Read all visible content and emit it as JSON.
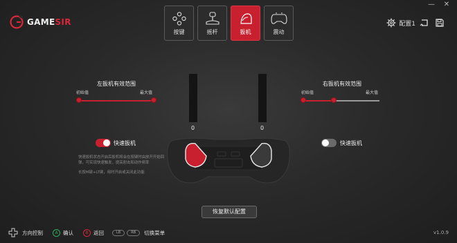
{
  "brand": {
    "name_left": "GAME",
    "name_right": "SIR"
  },
  "window": {
    "minimize": "—",
    "close": "✕"
  },
  "tabs": [
    {
      "label": "按键",
      "icon": "dpad-buttons-icon",
      "active": false
    },
    {
      "label": "摇杆",
      "icon": "joystick-icon",
      "active": false
    },
    {
      "label": "扳机",
      "icon": "trigger-icon",
      "active": true
    },
    {
      "label": "震动",
      "icon": "vibration-controller-icon",
      "active": false
    }
  ],
  "header": {
    "config_label": "配置1"
  },
  "left_range": {
    "title": "左扳机有效范围",
    "min_label": "初始值",
    "max_label": "最大值",
    "min_value": 0.0,
    "max_value": 1.0
  },
  "right_range": {
    "title": "右扳机有效范围",
    "min_label": "初始值",
    "max_label": "最大值",
    "min_value": 0.0,
    "max_value": 0.42
  },
  "left_trigger_value": "0",
  "right_trigger_value": "0",
  "left_quick_trigger": {
    "label": "快速扳机",
    "enabled": true
  },
  "right_quick_trigger": {
    "label": "快速扳机",
    "enabled": false
  },
  "description": {
    "line1": "快速扳机状态开启后扳机将会在按键时由放开开始回",
    "line2": "弹，可实现快速触发，提高射击和动作频率",
    "line3": "长按M键+LT键，用时开启或关闭此功能"
  },
  "reset_button": "恢复默认配置",
  "footer": {
    "dpad_label": "方向控制",
    "confirm_key": "A",
    "confirm_label": "确认",
    "back_key": "B",
    "back_label": "返回",
    "lb_key": "LB",
    "rb_key": "RB",
    "switch_label": "切换菜单",
    "version": "v1.0.9"
  },
  "colors": {
    "accent": "#c8202e",
    "bg": "#2a2a2a",
    "confirm": "#2fae5a",
    "back": "#d8283a"
  }
}
